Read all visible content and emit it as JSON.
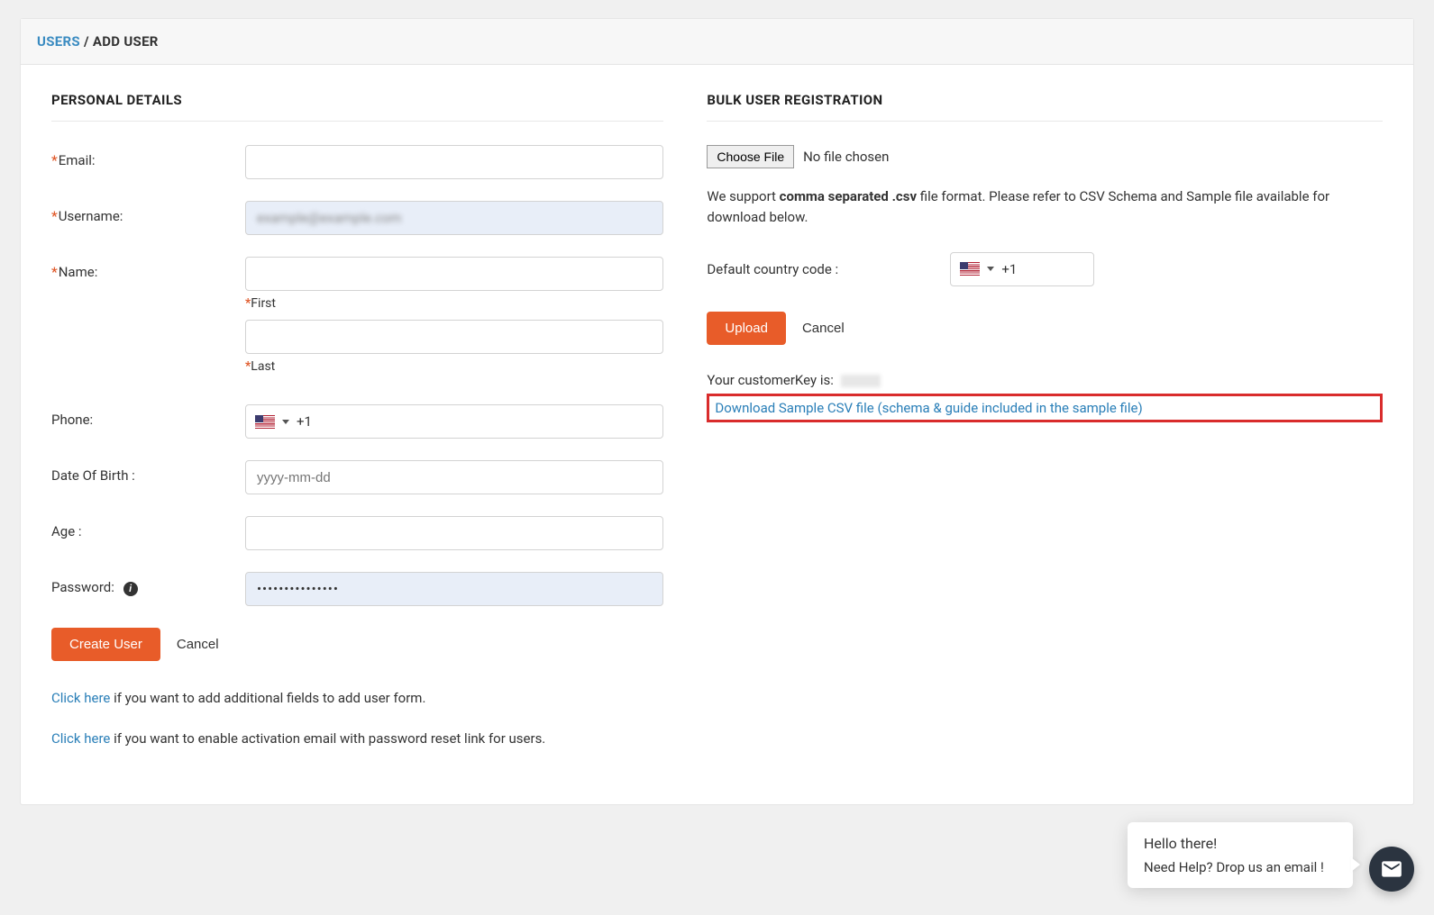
{
  "breadcrumb": {
    "root": "USERS",
    "sep": "/",
    "current": "ADD USER"
  },
  "personal": {
    "title": "PERSONAL DETAILS",
    "email_label": "Email:",
    "email_value": "",
    "username_label": "Username:",
    "username_value": "example@example.com",
    "name_label": "Name:",
    "first_sub": "First",
    "first_value": "",
    "last_sub": "Last",
    "last_value": "",
    "phone_label": "Phone:",
    "phone_dial": "+1",
    "dob_label": "Date Of Birth :",
    "dob_placeholder": "yyyy-mm-dd",
    "dob_value": "",
    "age_label": "Age :",
    "age_value": "",
    "password_label": "Password:",
    "password_value": "•••••••••••••••",
    "create_btn": "Create User",
    "cancel_btn": "Cancel",
    "helper1_link": "Click here",
    "helper1_rest": " if you want to add additional fields to add user form.",
    "helper2_link": "Click here",
    "helper2_rest": " if you want to enable activation email with password reset link for users."
  },
  "bulk": {
    "title": "BULK USER REGISTRATION",
    "choose_file_btn": "Choose File",
    "no_file": "No file chosen",
    "support_pre": "We support ",
    "support_bold": "comma separated .csv",
    "support_post": " file format. Please refer to CSV Schema and Sample file available for download below.",
    "cc_label": "Default country code :",
    "cc_dial": "+1",
    "upload_btn": "Upload",
    "cancel_btn": "Cancel",
    "key_label": "Your customerKey is:",
    "download_link": "Download Sample CSV file (schema & guide included in the sample file)"
  },
  "chat": {
    "line1": "Hello there!",
    "line2": "Need Help? Drop us an email !"
  }
}
